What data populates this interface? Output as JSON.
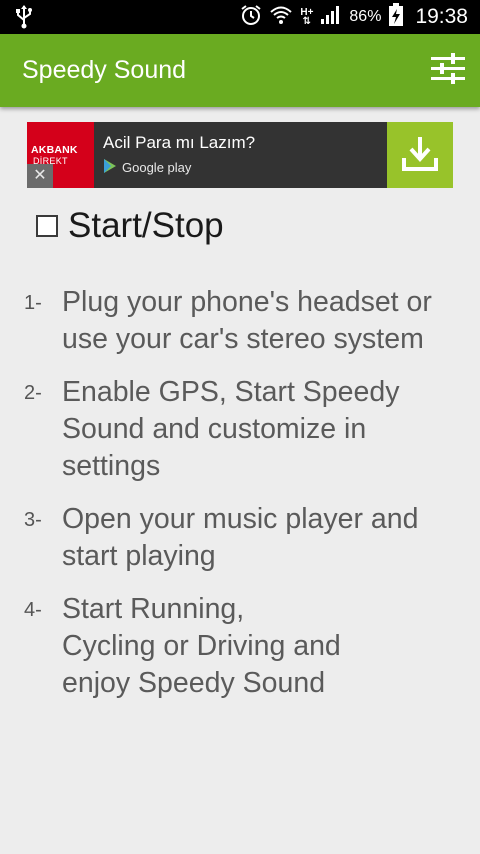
{
  "status_bar": {
    "battery": "86%",
    "time": "19:38",
    "network": "H+",
    "icons": [
      "usb-icon",
      "alarm-icon",
      "wifi-icon",
      "signal-icon",
      "battery-charging-icon"
    ]
  },
  "app_bar": {
    "title": "Speedy Sound",
    "settings_icon": "sliders-icon",
    "color": "#6aab21"
  },
  "ad": {
    "brand_line1": "AKBANK",
    "brand_line2": "DİREKT",
    "headline": "Acil Para mı Lazım?",
    "store_label": "Google play",
    "close_icon": "close-icon",
    "download_icon": "download-icon",
    "accent": "#98c32a"
  },
  "start_stop": {
    "label": "Start/Stop",
    "checked": false
  },
  "steps": [
    {
      "num": "1-",
      "text": "Plug your phone's headset or\nuse your car's stereo system"
    },
    {
      "num": "2-",
      "text": "Enable GPS, Start Speedy\nSound and customize in\nsettings"
    },
    {
      "num": "3-",
      "text": "Open your music player and\nstart playing"
    },
    {
      "num": "4-",
      "text": "Start Running,\nCycling or Driving and\nenjoy Speedy Sound"
    }
  ]
}
